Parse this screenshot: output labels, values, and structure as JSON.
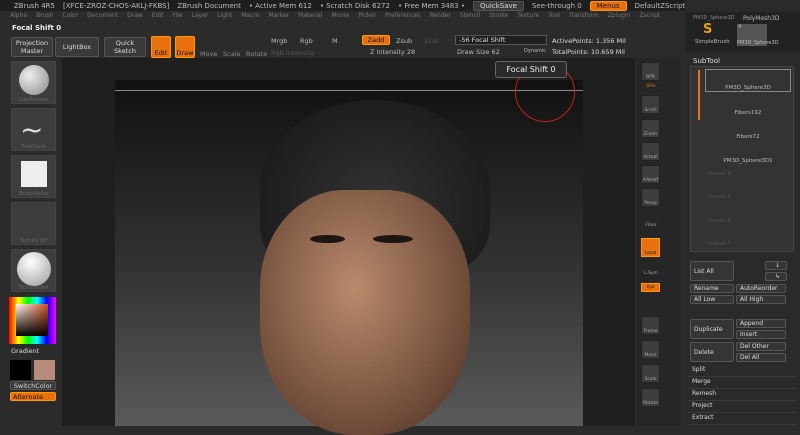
{
  "titlebar": {
    "app": "ZBrush 4R5",
    "serial": "[XFCE-ZROZ-CHOS-AKLJ-FKBS]",
    "doc": "ZBrush Document",
    "active_mem": "• Active Mem 612",
    "scratch": "• Scratch Disk 6272",
    "free_mem": "• Free Mem 3483 •",
    "quicksave": "QuickSave",
    "see_through": "See-through  0",
    "menus": "Menus",
    "script": "DefaultZScript"
  },
  "menu": [
    "Alpha",
    "Brush",
    "Color",
    "Document",
    "Draw",
    "Edit",
    "File",
    "Layer",
    "Light",
    "Macro",
    "Marker",
    "Material",
    "Movie",
    "Picker",
    "Preferences",
    "Render",
    "Stencil",
    "Stroke",
    "Texture",
    "Tool",
    "Transform",
    "Zplugin",
    "Zscript"
  ],
  "focal_shift_label": "Focal Shift  0",
  "toolbar": {
    "projection_master": "Projection Master",
    "lightbox": "LightBox",
    "quick_sketch": "Quick Sketch",
    "edit": "Edit",
    "draw": "Draw",
    "move": "Move",
    "scale": "Scale",
    "rotate": "Rotate",
    "mrgb": "Mrgb",
    "rgb": "Rgb",
    "m": "M",
    "rgb_intensity": "Rgb Intensity",
    "zadd": "Zadd",
    "zsub": "Zsub",
    "zcut": "Zcut",
    "z_intensity": "Z Intensity 28",
    "focal_shift": "-56 Focal Shift",
    "draw_size": "Draw Size 62",
    "dynamic": "Dynamic",
    "active_points": "ActivePoints: 1.356 Mil",
    "total_points": "TotalPoints: 10.659 Mil"
  },
  "leftshelf": {
    "brush": "ClayBuildup",
    "stroke": "FreeHand",
    "alpha": "BrushAlpha",
    "texture": "Texture Off",
    "material": "SkinShade4",
    "gradient": "Gradient",
    "switch": "SwitchColor",
    "alternate": "Alternate"
  },
  "rightshelf": [
    "BPR",
    "SPix",
    "Scroll",
    "Zoom",
    "Actual",
    "AAHalf",
    "Persp",
    "Floor",
    "Local",
    "L.Sym",
    "Xyz",
    "Frame",
    "Move",
    "Scale",
    "Rotate"
  ],
  "tooltip": "Focal Shift  0",
  "rightpanel": {
    "tool1": "PM3D_Sphere3D",
    "tool2": "PolyMesh3D",
    "simplebrush": "SimpleBrush",
    "tool_count": "4",
    "tool3": "PM3D_Sphere3D",
    "subtool_title": "SubTool",
    "subtools": [
      "PM3D_Sphere3D",
      "Fibers192",
      "Fibers72",
      "PM3D_Sphere3D1"
    ],
    "unused": [
      "Unused 4",
      "Unused 5",
      "Unused 6",
      "Unused 7"
    ],
    "list_all": "List All",
    "rename": "Rename",
    "autoreorder": "AutoReorder",
    "all_low": "All Low",
    "all_high": "All High",
    "duplicate": "Duplicate",
    "append": "Append",
    "insert": "Insert",
    "delete": "Delete",
    "del_other": "Del Other",
    "del_all": "Del All",
    "lines": [
      "Split",
      "Merge",
      "Remesh",
      "Project",
      "Extract"
    ]
  },
  "colors": {
    "accent": "#e8700f",
    "main_color": "#000000",
    "secondary_color": "#b88a7a"
  }
}
